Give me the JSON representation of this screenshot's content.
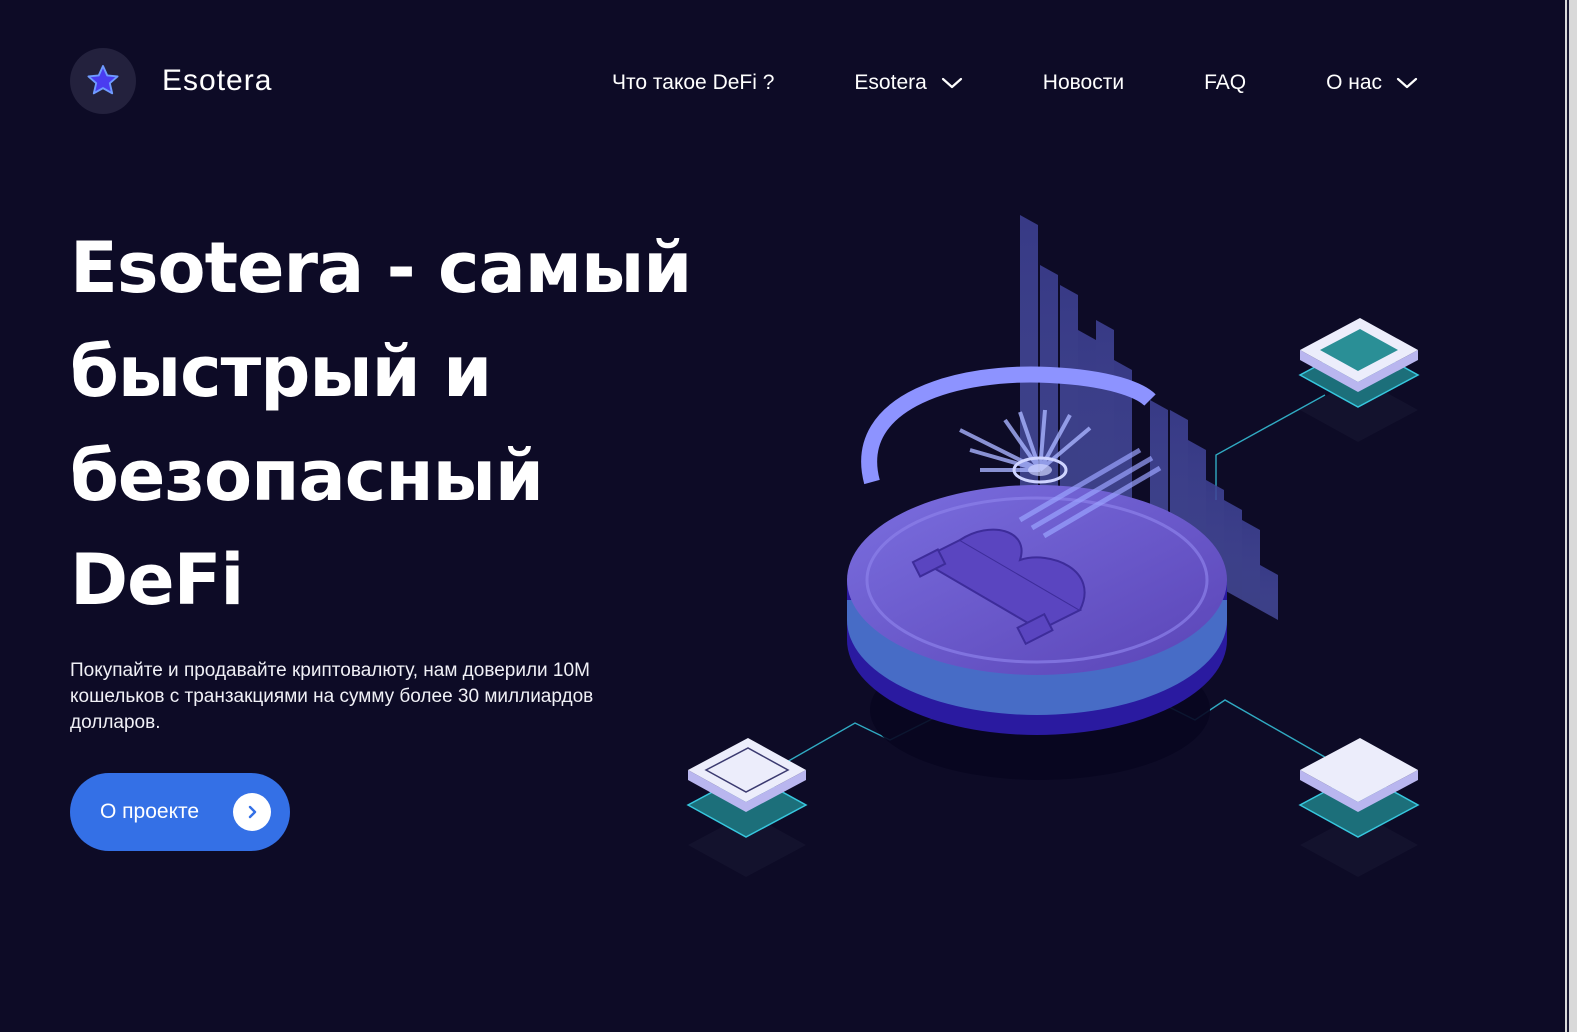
{
  "brand": {
    "name": "Esotera",
    "logo_icon": "star-icon"
  },
  "nav": {
    "items": [
      {
        "label": "Что такое DeFi ?",
        "has_dropdown": false
      },
      {
        "label": "Esotera",
        "has_dropdown": true
      },
      {
        "label": "Новости",
        "has_dropdown": false
      },
      {
        "label": "FAQ",
        "has_dropdown": false
      },
      {
        "label": "О нас",
        "has_dropdown": true
      }
    ]
  },
  "hero": {
    "title_lines": [
      "Esotera - самый",
      "быстрый и",
      "безопасный",
      "DeFi"
    ],
    "description": "Покупайте и продавайте криптовалюту, нам доверили 10M кошельков с транзакциями на сумму более 30 миллиардов долларов.",
    "cta_label": "О проекте",
    "cta_icon": "chevron-right-icon"
  },
  "colors": {
    "background": "#0d0b26",
    "accent": "#3470e6",
    "coin": "#6a55c8",
    "line": "#37c7de"
  }
}
